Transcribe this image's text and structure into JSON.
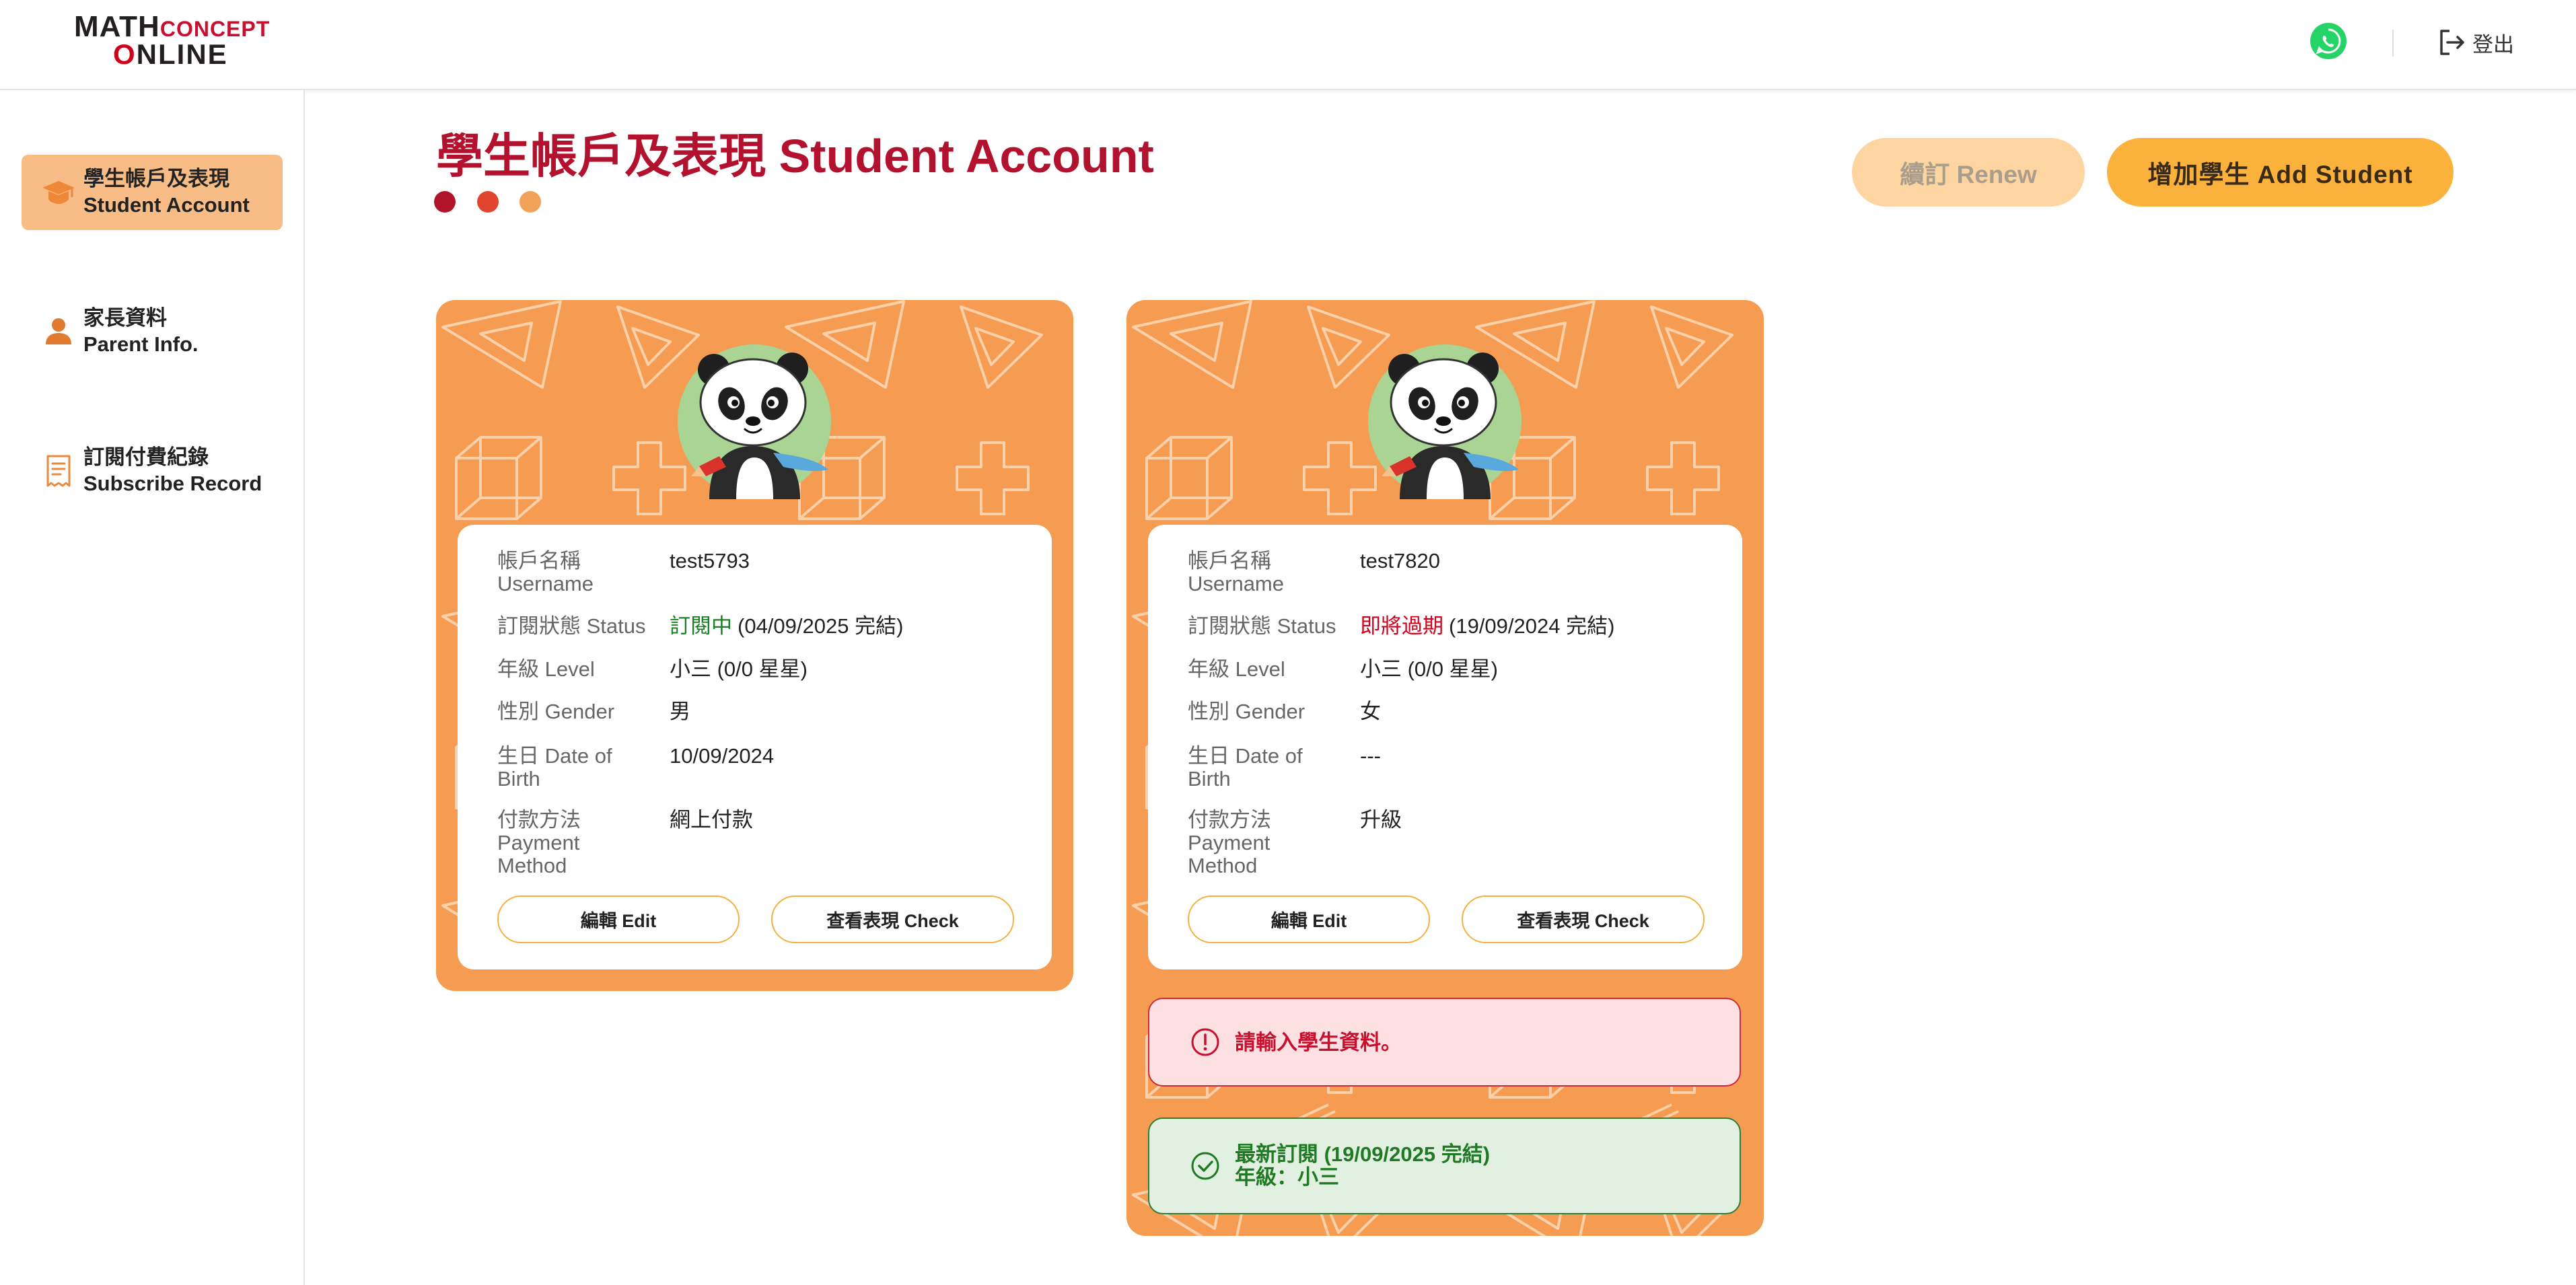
{
  "header": {
    "logo": {
      "math": "MATH",
      "concept": "CONCEPT",
      "online": "ONLINE"
    },
    "whatsapp_icon": "whatsapp-icon",
    "logout_icon": "logout-icon",
    "logout_label": "登出"
  },
  "sidebar": {
    "items": [
      {
        "label_zh": "學生帳戶及表現",
        "label_en": "Student Account",
        "icon": "graduation-cap-icon",
        "active": true
      },
      {
        "label_zh": "家長資料",
        "label_en": "Parent Info.",
        "icon": "person-icon",
        "active": false
      },
      {
        "label_zh": "訂閱付費紀錄",
        "label_en": "Subscribe Record",
        "icon": "receipt-icon",
        "active": false
      }
    ]
  },
  "page": {
    "title": "學生帳戶及表現 Student Account",
    "renew_label": "續訂 Renew",
    "add_student_label": "增加學生 Add Student"
  },
  "field_labels": {
    "username": "帳戶名稱 Username",
    "status": "訂閱狀態 Status",
    "level": "年級 Level",
    "gender": "性別 Gender",
    "dob": "生日 Date of Birth",
    "payment": "付款方法 Payment Method"
  },
  "card_actions": {
    "edit": "編輯 Edit",
    "check": "查看表現 Check"
  },
  "students": [
    {
      "username": "test5793",
      "status_text": "訂閱中",
      "status_detail": "(04/09/2025 完結)",
      "status_color": "#1a7f22",
      "level": "小三 (0/0 星星)",
      "gender": "男",
      "dob": "10/09/2024",
      "payment_method": "網上付款"
    },
    {
      "username": "test7820",
      "status_text": "即將過期",
      "status_detail": "(19/09/2024 完結)",
      "status_color": "#d0021b",
      "level": "小三 (0/0 星星)",
      "gender": "女",
      "dob": "---",
      "payment_method": "升級",
      "alerts": {
        "error": "請輸入學生資料。",
        "success_line1": "最新訂閱 (19/09/2025 完結)",
        "success_line2": "年級：小三"
      }
    }
  ],
  "colors": {
    "title_red": "#b3122e",
    "card_orange": "#f59b52",
    "accent_yellow": "#fbb23d",
    "nav_active": "#f8bd86",
    "dots": [
      "#b1132b",
      "#e2452f",
      "#f2a35a"
    ]
  }
}
